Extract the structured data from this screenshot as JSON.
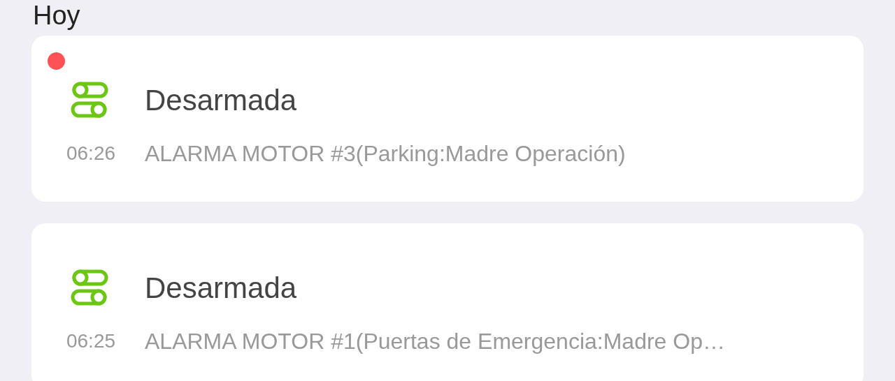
{
  "section_title": "Hoy",
  "events": [
    {
      "unread": true,
      "title": "Desarmada",
      "time": "06:26",
      "message": "ALARMA MOTOR #3(Parking:Madre Operación)"
    },
    {
      "unread": false,
      "title": "Desarmada",
      "time": "06:25",
      "message": "ALARMA MOTOR #1(Puertas de Emergencia:Madre Op…"
    }
  ]
}
